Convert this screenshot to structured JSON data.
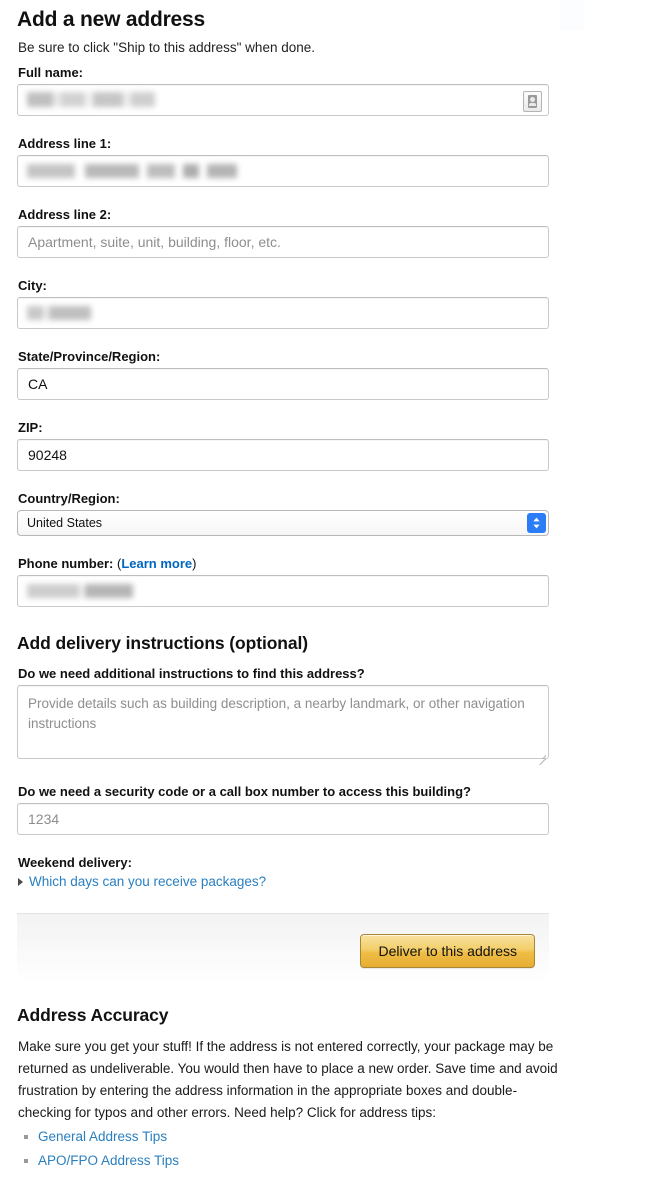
{
  "page": {
    "title": "Add a new address",
    "subtitle": "Be sure to click \"Ship to this address\" when done."
  },
  "form": {
    "full_name": {
      "label": "Full name:",
      "value": "",
      "placeholder": "",
      "redacted": true,
      "autofill_icon": "contact-card-icon"
    },
    "address_line_1": {
      "label": "Address line 1:",
      "value": "",
      "placeholder": "",
      "redacted": true
    },
    "address_line_2": {
      "label": "Address line 2:",
      "value": "",
      "placeholder": "Apartment, suite, unit, building, floor, etc."
    },
    "city": {
      "label": "City:",
      "value": "",
      "placeholder": "",
      "redacted": true
    },
    "state": {
      "label": "State/Province/Region:",
      "value": "CA",
      "placeholder": ""
    },
    "zip": {
      "label": "ZIP:",
      "value": "90248",
      "placeholder": ""
    },
    "country": {
      "label": "Country/Region:",
      "selected": "United States"
    },
    "phone": {
      "label": "Phone number:",
      "paren_open": "(",
      "learn_more": "Learn more",
      "paren_close": ")",
      "value": "",
      "placeholder": "",
      "redacted": true
    }
  },
  "delivery_instructions": {
    "heading": "Add delivery instructions (optional)",
    "additional_instructions": {
      "label": "Do we need additional instructions to find this address?",
      "value": "",
      "placeholder": "Provide details such as building description, a nearby landmark, or other navigation instructions"
    },
    "security_code": {
      "label": "Do we need a security code or a call box number to access this building?",
      "value": "",
      "placeholder": "1234"
    },
    "weekend": {
      "label": "Weekend delivery:",
      "expander_link": "Which days can you receive packages?",
      "expander_icon": "triangle-right-icon"
    }
  },
  "actions": {
    "deliver_button": "Deliver to this address"
  },
  "accuracy": {
    "heading": "Address Accuracy",
    "body": "Make sure you get your stuff! If the address is not entered correctly, your package may be returned as undeliverable. You would then have to place a new order. Save time and avoid frustration by entering the address information in the appropriate boxes and double-checking for typos and other errors. Need help? Click for address tips:",
    "tips": [
      {
        "label": "General Address Tips"
      },
      {
        "label": "APO/FPO Address Tips"
      }
    ]
  },
  "colors": {
    "link_blue": "#2a7fc0",
    "learn_more_blue": "#0066c0",
    "button_gold": "#f0c14b",
    "button_border": "#a88734",
    "select_accent": "#2b7cf7",
    "field_border": "#c9c9c9"
  }
}
